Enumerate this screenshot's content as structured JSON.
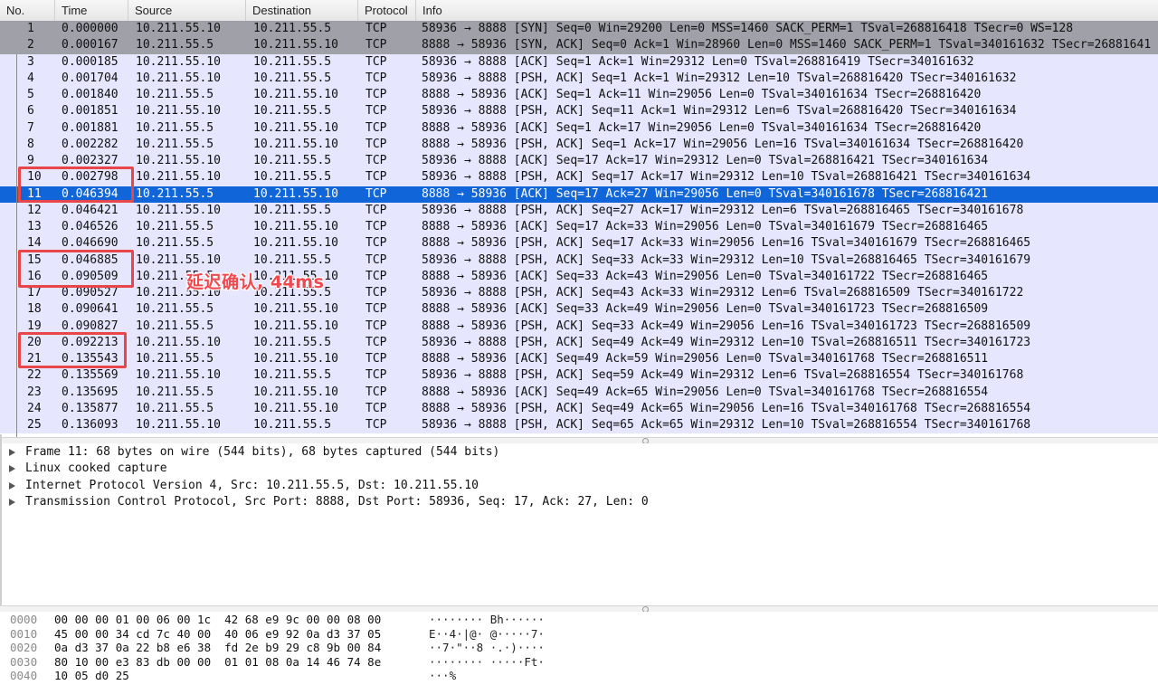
{
  "packet_list": {
    "columns": {
      "no": "No.",
      "time": "Time",
      "source": "Source",
      "destination": "Destination",
      "protocol": "Protocol",
      "info": "Info"
    },
    "rows": [
      {
        "no": "1",
        "time": "0.000000",
        "source": "10.211.55.10",
        "destination": "10.211.55.5",
        "protocol": "TCP",
        "info": "58936 → 8888 [SYN] Seq=0 Win=29200 Len=0 MSS=1460 SACK_PERM=1 TSval=268816418 TSecr=0 WS=128"
      },
      {
        "no": "2",
        "time": "0.000167",
        "source": "10.211.55.5",
        "destination": "10.211.55.10",
        "protocol": "TCP",
        "info": "8888 → 58936 [SYN, ACK] Seq=0 Ack=1 Win=28960 Len=0 MSS=1460 SACK_PERM=1 TSval=340161632 TSecr=26881641"
      },
      {
        "no": "3",
        "time": "0.000185",
        "source": "10.211.55.10",
        "destination": "10.211.55.5",
        "protocol": "TCP",
        "info": "58936 → 8888 [ACK] Seq=1 Ack=1 Win=29312 Len=0 TSval=268816419 TSecr=340161632"
      },
      {
        "no": "4",
        "time": "0.001704",
        "source": "10.211.55.10",
        "destination": "10.211.55.5",
        "protocol": "TCP",
        "info": "58936 → 8888 [PSH, ACK] Seq=1 Ack=1 Win=29312 Len=10 TSval=268816420 TSecr=340161632"
      },
      {
        "no": "5",
        "time": "0.001840",
        "source": "10.211.55.5",
        "destination": "10.211.55.10",
        "protocol": "TCP",
        "info": "8888 → 58936 [ACK] Seq=1 Ack=11 Win=29056 Len=0 TSval=340161634 TSecr=268816420"
      },
      {
        "no": "6",
        "time": "0.001851",
        "source": "10.211.55.10",
        "destination": "10.211.55.5",
        "protocol": "TCP",
        "info": "58936 → 8888 [PSH, ACK] Seq=11 Ack=1 Win=29312 Len=6 TSval=268816420 TSecr=340161634"
      },
      {
        "no": "7",
        "time": "0.001881",
        "source": "10.211.55.5",
        "destination": "10.211.55.10",
        "protocol": "TCP",
        "info": "8888 → 58936 [ACK] Seq=1 Ack=17 Win=29056 Len=0 TSval=340161634 TSecr=268816420"
      },
      {
        "no": "8",
        "time": "0.002282",
        "source": "10.211.55.5",
        "destination": "10.211.55.10",
        "protocol": "TCP",
        "info": "8888 → 58936 [PSH, ACK] Seq=1 Ack=17 Win=29056 Len=16 TSval=340161634 TSecr=268816420"
      },
      {
        "no": "9",
        "time": "0.002327",
        "source": "10.211.55.10",
        "destination": "10.211.55.5",
        "protocol": "TCP",
        "info": "58936 → 8888 [ACK] Seq=17 Ack=17 Win=29312 Len=0 TSval=268816421 TSecr=340161634"
      },
      {
        "no": "10",
        "time": "0.002798",
        "source": "10.211.55.10",
        "destination": "10.211.55.5",
        "protocol": "TCP",
        "info": "58936 → 8888 [PSH, ACK] Seq=17 Ack=17 Win=29312 Len=10 TSval=268816421 TSecr=340161634"
      },
      {
        "no": "11",
        "time": "0.046394",
        "source": "10.211.55.5",
        "destination": "10.211.55.10",
        "protocol": "TCP",
        "info": "8888 → 58936 [ACK] Seq=17 Ack=27 Win=29056 Len=0 TSval=340161678 TSecr=268816421"
      },
      {
        "no": "12",
        "time": "0.046421",
        "source": "10.211.55.10",
        "destination": "10.211.55.5",
        "protocol": "TCP",
        "info": "58936 → 8888 [PSH, ACK] Seq=27 Ack=17 Win=29312 Len=6 TSval=268816465 TSecr=340161678"
      },
      {
        "no": "13",
        "time": "0.046526",
        "source": "10.211.55.5",
        "destination": "10.211.55.10",
        "protocol": "TCP",
        "info": "8888 → 58936 [ACK] Seq=17 Ack=33 Win=29056 Len=0 TSval=340161679 TSecr=268816465"
      },
      {
        "no": "14",
        "time": "0.046690",
        "source": "10.211.55.5",
        "destination": "10.211.55.10",
        "protocol": "TCP",
        "info": "8888 → 58936 [PSH, ACK] Seq=17 Ack=33 Win=29056 Len=16 TSval=340161679 TSecr=268816465"
      },
      {
        "no": "15",
        "time": "0.046885",
        "source": "10.211.55.10",
        "destination": "10.211.55.5",
        "protocol": "TCP",
        "info": "58936 → 8888 [PSH, ACK] Seq=33 Ack=33 Win=29312 Len=10 TSval=268816465 TSecr=340161679"
      },
      {
        "no": "16",
        "time": "0.090509",
        "source": "10.211.55.5",
        "destination": "10.211.55.10",
        "protocol": "TCP",
        "info": "8888 → 58936 [ACK] Seq=33 Ack=43 Win=29056 Len=0 TSval=340161722 TSecr=268816465"
      },
      {
        "no": "17",
        "time": "0.090527",
        "source": "10.211.55.10",
        "destination": "10.211.55.5",
        "protocol": "TCP",
        "info": "58936 → 8888 [PSH, ACK] Seq=43 Ack=33 Win=29312 Len=6 TSval=268816509 TSecr=340161722"
      },
      {
        "no": "18",
        "time": "0.090641",
        "source": "10.211.55.5",
        "destination": "10.211.55.10",
        "protocol": "TCP",
        "info": "8888 → 58936 [ACK] Seq=33 Ack=49 Win=29056 Len=0 TSval=340161723 TSecr=268816509"
      },
      {
        "no": "19",
        "time": "0.090827",
        "source": "10.211.55.5",
        "destination": "10.211.55.10",
        "protocol": "TCP",
        "info": "8888 → 58936 [PSH, ACK] Seq=33 Ack=49 Win=29056 Len=16 TSval=340161723 TSecr=268816509"
      },
      {
        "no": "20",
        "time": "0.092213",
        "source": "10.211.55.10",
        "destination": "10.211.55.5",
        "protocol": "TCP",
        "info": "58936 → 8888 [PSH, ACK] Seq=49 Ack=49 Win=29312 Len=10 TSval=268816511 TSecr=340161723"
      },
      {
        "no": "21",
        "time": "0.135543",
        "source": "10.211.55.5",
        "destination": "10.211.55.10",
        "protocol": "TCP",
        "info": "8888 → 58936 [ACK] Seq=49 Ack=59 Win=29056 Len=0 TSval=340161768 TSecr=268816511"
      },
      {
        "no": "22",
        "time": "0.135569",
        "source": "10.211.55.10",
        "destination": "10.211.55.5",
        "protocol": "TCP",
        "info": "58936 → 8888 [PSH, ACK] Seq=59 Ack=49 Win=29312 Len=6 TSval=268816554 TSecr=340161768"
      },
      {
        "no": "23",
        "time": "0.135695",
        "source": "10.211.55.5",
        "destination": "10.211.55.10",
        "protocol": "TCP",
        "info": "8888 → 58936 [ACK] Seq=49 Ack=65 Win=29056 Len=0 TSval=340161768 TSecr=268816554"
      },
      {
        "no": "24",
        "time": "0.135877",
        "source": "10.211.55.5",
        "destination": "10.211.55.10",
        "protocol": "TCP",
        "info": "8888 → 58936 [PSH, ACK] Seq=49 Ack=65 Win=29056 Len=16 TSval=340161768 TSecr=268816554"
      },
      {
        "no": "25",
        "time": "0.136093",
        "source": "10.211.55.10",
        "destination": "10.211.55.5",
        "protocol": "TCP",
        "info": "58936 → 8888 [PSH, ACK] Seq=65 Ack=65 Win=29312 Len=10 TSval=268816554 TSecr=340161768"
      }
    ],
    "selected_no": "11",
    "annotation": "延迟确认, 44ms",
    "colors": {
      "syn_rows": "#a0a0a8",
      "tcp_rows": "#e7e6ff",
      "selected": "#1065d8",
      "annotation": "#ef4a4f"
    }
  },
  "details": [
    {
      "text": "Frame 11: 68 bytes on wire (544 bits), 68 bytes captured (544 bits)",
      "icon": "expand-triangle-icon"
    },
    {
      "text": "Linux cooked capture",
      "icon": "expand-triangle-icon"
    },
    {
      "text": "Internet Protocol Version 4, Src: 10.211.55.5, Dst: 10.211.55.10",
      "icon": "expand-triangle-icon"
    },
    {
      "text": "Transmission Control Protocol, Src Port: 8888, Dst Port: 58936, Seq: 17, Ack: 27, Len: 0",
      "icon": "expand-triangle-icon"
    }
  ],
  "bytes": [
    {
      "offset": "0000",
      "hex": "00 00 00 01 00 06 00 1c  42 68 e9 9c 00 00 08 00",
      "ascii": "········ Bh······"
    },
    {
      "offset": "0010",
      "hex": "45 00 00 34 cd 7c 40 00  40 06 e9 92 0a d3 37 05",
      "ascii": "E··4·|@· @·····7·"
    },
    {
      "offset": "0020",
      "hex": "0a d3 37 0a 22 b8 e6 38  fd 2e b9 29 c8 9b 00 84",
      "ascii": "··7·\"··8 ·.·)····"
    },
    {
      "offset": "0030",
      "hex": "80 10 00 e3 83 db 00 00  01 01 08 0a 14 46 74 8e",
      "ascii": "········ ·····Ft·"
    },
    {
      "offset": "0040",
      "hex": "10 05 d0 25",
      "ascii": "···%"
    }
  ]
}
